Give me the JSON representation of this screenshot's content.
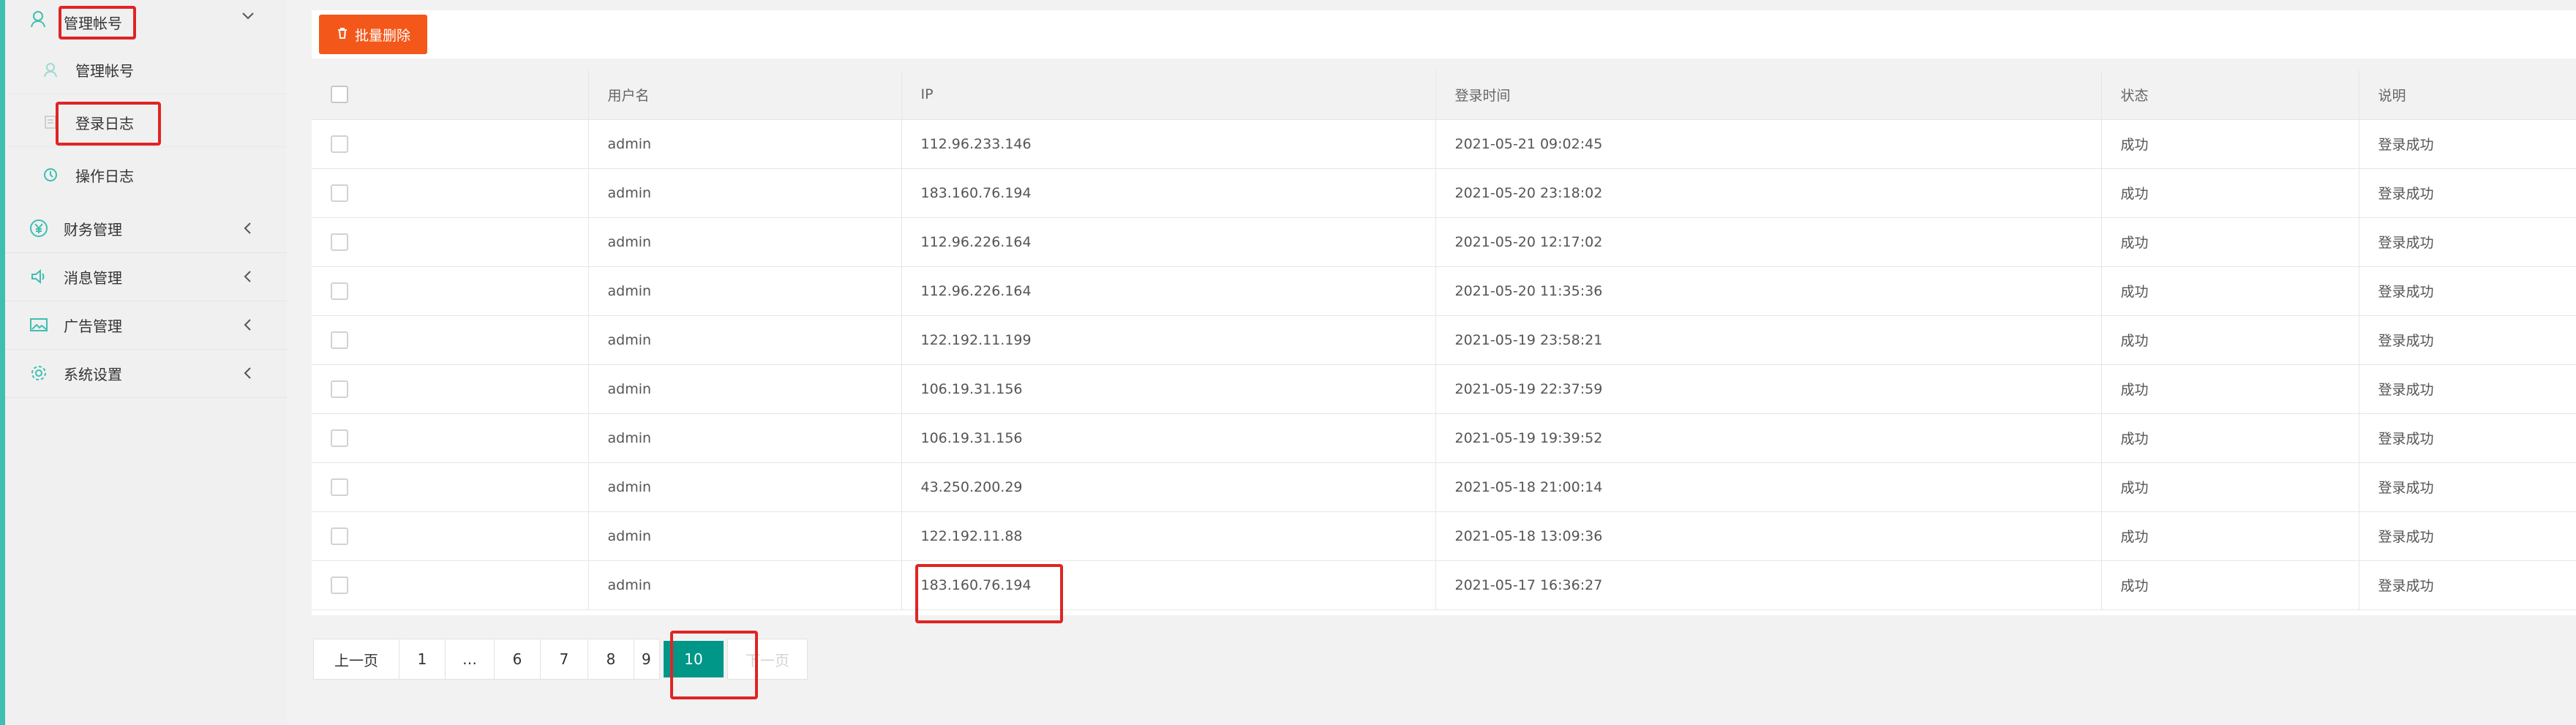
{
  "sidebar": {
    "accounts": {
      "label": "管理帐号"
    },
    "sub_items": [
      {
        "label": "管理帐号"
      },
      {
        "label": "登录日志"
      },
      {
        "label": "操作日志"
      }
    ],
    "menus": [
      {
        "label": "财务管理"
      },
      {
        "label": "消息管理"
      },
      {
        "label": "广告管理"
      },
      {
        "label": "系统设置"
      }
    ]
  },
  "toolbar": {
    "batch_delete_label": "批量删除"
  },
  "table": {
    "headers": {
      "username": "用户名",
      "ip": "IP",
      "login_time": "登录时间",
      "status": "状态",
      "note": "说明"
    },
    "rows": [
      {
        "username": "admin",
        "ip": "112.96.233.146",
        "login_time": "2021-05-21 09:02:45",
        "status": "成功",
        "note": "登录成功"
      },
      {
        "username": "admin",
        "ip": "183.160.76.194",
        "login_time": "2021-05-20 23:18:02",
        "status": "成功",
        "note": "登录成功"
      },
      {
        "username": "admin",
        "ip": "112.96.226.164",
        "login_time": "2021-05-20 12:17:02",
        "status": "成功",
        "note": "登录成功"
      },
      {
        "username": "admin",
        "ip": "112.96.226.164",
        "login_time": "2021-05-20 11:35:36",
        "status": "成功",
        "note": "登录成功"
      },
      {
        "username": "admin",
        "ip": "122.192.11.199",
        "login_time": "2021-05-19 23:58:21",
        "status": "成功",
        "note": "登录成功"
      },
      {
        "username": "admin",
        "ip": "106.19.31.156",
        "login_time": "2021-05-19 22:37:59",
        "status": "成功",
        "note": "登录成功"
      },
      {
        "username": "admin",
        "ip": "106.19.31.156",
        "login_time": "2021-05-19 19:39:52",
        "status": "成功",
        "note": "登录成功"
      },
      {
        "username": "admin",
        "ip": "43.250.200.29",
        "login_time": "2021-05-18 21:00:14",
        "status": "成功",
        "note": "登录成功"
      },
      {
        "username": "admin",
        "ip": "122.192.11.88",
        "login_time": "2021-05-18 13:09:36",
        "status": "成功",
        "note": "登录成功"
      },
      {
        "username": "admin",
        "ip": "183.160.76.194",
        "login_time": "2021-05-17 16:36:27",
        "status": "成功",
        "note": "登录成功"
      }
    ]
  },
  "pager": {
    "prev": "上一页",
    "first": "1",
    "ellipsis": "…",
    "p6": "6",
    "p7": "7",
    "p8": "8",
    "p9": "9",
    "current": "10",
    "next": "下一页"
  },
  "colors": {
    "accent": "#3fbfb0",
    "danger": "#f3581a",
    "current_page": "#009688",
    "highlight": "#e02424"
  },
  "icons": {
    "account": "user-icon",
    "finance": "yen-icon",
    "message": "speaker-icon",
    "ads": "image-icon",
    "settings": "gear-icon",
    "arrow_open": "chevron-down-icon",
    "arrow_closed": "chevron-left-icon",
    "delete": "trash-icon"
  }
}
